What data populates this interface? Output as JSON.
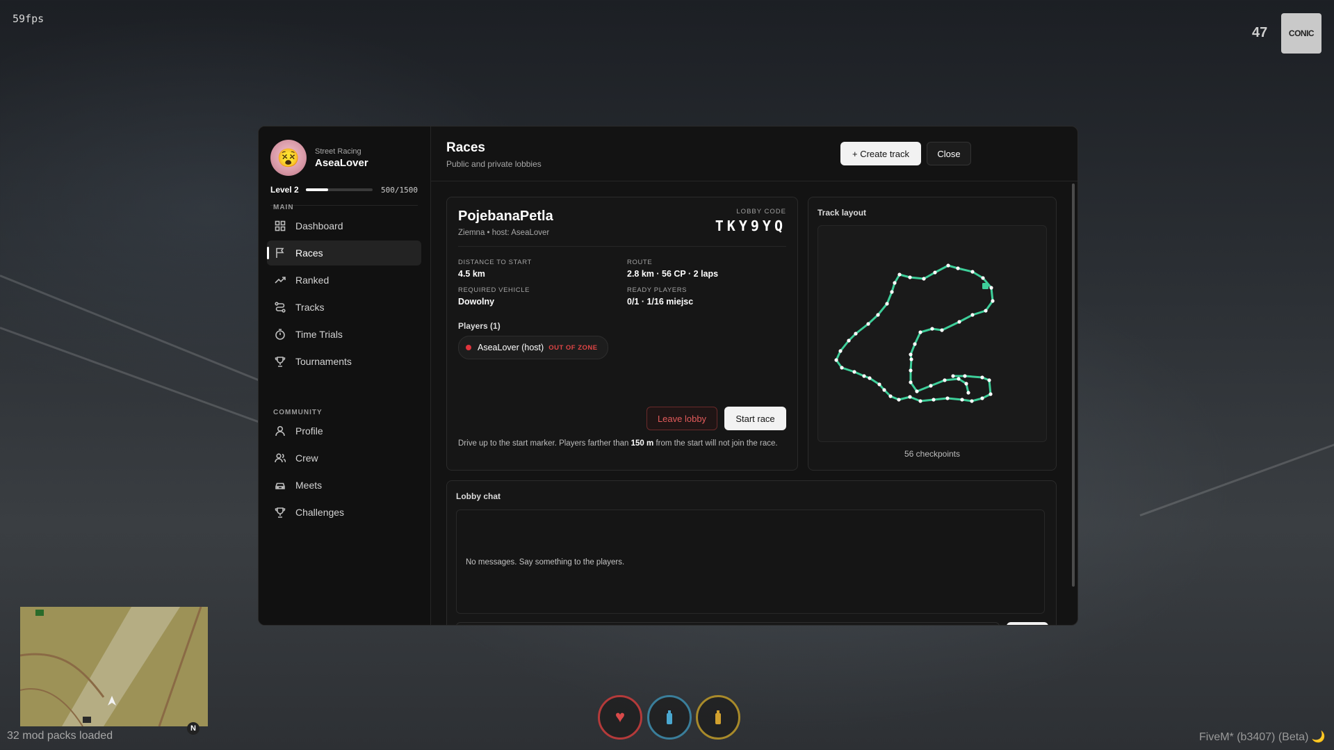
{
  "hud": {
    "fps": "59fps",
    "top_right_number": "47",
    "logo_text": "CONIC",
    "mods_loaded": "32 mod packs loaded",
    "client_version": "FiveM* (b3407) (Beta) 🌙",
    "north_label": "N"
  },
  "sidebar": {
    "profile": {
      "subtitle": "Street Racing",
      "name": "AseaLover",
      "avatar_emoji": "😵"
    },
    "level": {
      "label": "Level 2",
      "xp_text": "500/1500",
      "progress": 0.333
    },
    "sections": [
      {
        "label": "MAIN"
      },
      {
        "label": "COMMUNITY"
      }
    ],
    "items": [
      {
        "label": "Dashboard",
        "icon": "grid-icon"
      },
      {
        "label": "Races",
        "icon": "flag-icon",
        "active": true
      },
      {
        "label": "Ranked",
        "icon": "trend-icon"
      },
      {
        "label": "Tracks",
        "icon": "route-icon"
      },
      {
        "label": "Time Trials",
        "icon": "timer-icon"
      },
      {
        "label": "Tournaments",
        "icon": "trophy-icon"
      },
      {
        "label": "Profile",
        "icon": "user-icon"
      },
      {
        "label": "Crew",
        "icon": "users-icon"
      },
      {
        "label": "Meets",
        "icon": "car-icon"
      },
      {
        "label": "Challenges",
        "icon": "trophy-icon"
      }
    ]
  },
  "header": {
    "title": "Races",
    "subtitle": "Public and private lobbies",
    "create_label": "+ Create track",
    "close_label": "Close"
  },
  "lobby": {
    "name": "PojebanaPetla",
    "meta": "Ziemna • host: AseaLover",
    "code_label": "LOBBY CODE",
    "code": "TKY9YQ",
    "stats": [
      {
        "label": "DISTANCE TO START",
        "value": "4.5 km"
      },
      {
        "label": "ROUTE",
        "value": "2.8 km · 56 CP · 2 laps"
      },
      {
        "label": "REQUIRED VEHICLE",
        "value": "Dowolny"
      },
      {
        "label": "READY PLAYERS",
        "value": "0/1 · 1/16 miejsc"
      }
    ],
    "players_title": "Players (1)",
    "player": {
      "name": "AseaLover (host)",
      "status": "OUT OF ZONE"
    },
    "leave_label": "Leave lobby",
    "start_label": "Start race",
    "note_prefix": "Drive up to the start marker. Players farther than ",
    "note_distance": "150 m",
    "note_suffix": " from the start will not join the race."
  },
  "track": {
    "title": "Track layout",
    "caption": "56 checkpoints",
    "line_color": "#3ecf9a"
  },
  "chat": {
    "title": "Lobby chat",
    "empty_text": "No messages. Say something to the players."
  },
  "colors": {
    "accent_green": "#3ecf9a",
    "danger_red": "#e04545"
  }
}
